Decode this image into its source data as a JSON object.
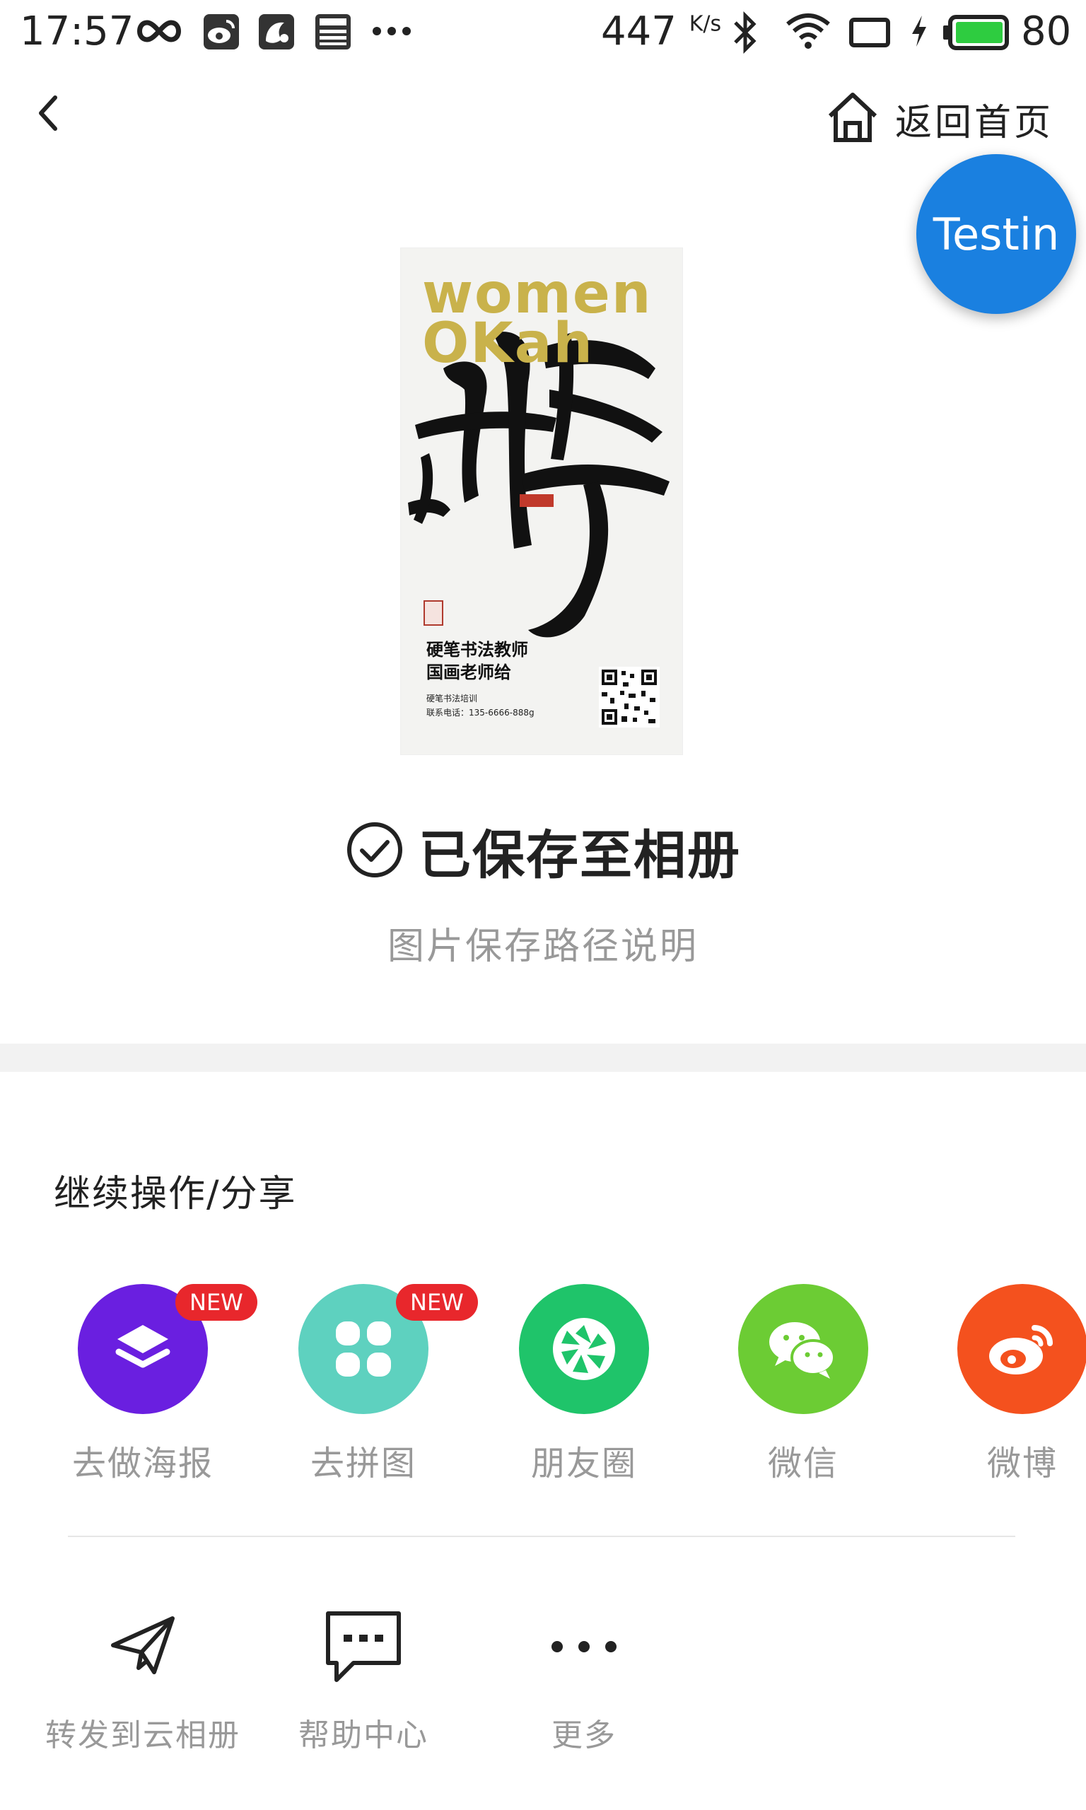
{
  "status_bar": {
    "time": "17:57",
    "speed": "447",
    "speed_unit": "K/s",
    "battery": "80",
    "icons": [
      "infinity-icon",
      "weibo-icon",
      "uc-browser-icon",
      "news-icon",
      "more-dots-icon",
      "bluetooth-icon",
      "wifi-icon",
      "screen-rotate-icon",
      "charging-icon",
      "battery-icon"
    ]
  },
  "nav": {
    "back_icon": "chevron-left-icon",
    "home_label": "返回首页",
    "home_icon": "home-icon"
  },
  "testin_badge": "Testin",
  "poster": {
    "title_line1": "women",
    "title_line2": "OKah",
    "line1": "硬笔书法教师",
    "line2": "国画老师给",
    "small1": "硬笔书法培训",
    "small2": "联系电话：135-6666-888g",
    "colors": {
      "title": "#c9b24b",
      "ink": "#111111",
      "seal": "#b03a2e"
    }
  },
  "saved": {
    "icon": "check-circle-icon",
    "text": "已保存至相册",
    "path_link": "图片保存路径说明"
  },
  "section_title": "继续操作/分享",
  "share_items": [
    {
      "label": "去做海报",
      "icon": "layers-icon",
      "color": "#6a1fe0",
      "badge": "NEW"
    },
    {
      "label": "去拼图",
      "icon": "grid-icon",
      "color": "#5ed1bf",
      "badge": "NEW"
    },
    {
      "label": "朋友圈",
      "icon": "moments-shutter-icon",
      "color": "#1fc46a",
      "badge": ""
    },
    {
      "label": "微信",
      "icon": "wechat-icon",
      "color": "#6ccc34",
      "badge": ""
    },
    {
      "label": "微博",
      "icon": "weibo-icon",
      "color": "#f4511e",
      "badge": ""
    }
  ],
  "tools": [
    {
      "label": "转发到云相册",
      "icon": "paper-plane-icon"
    },
    {
      "label": "帮助中心",
      "icon": "message-dots-icon"
    },
    {
      "label": "更多",
      "icon": "more-dots-icon"
    }
  ]
}
